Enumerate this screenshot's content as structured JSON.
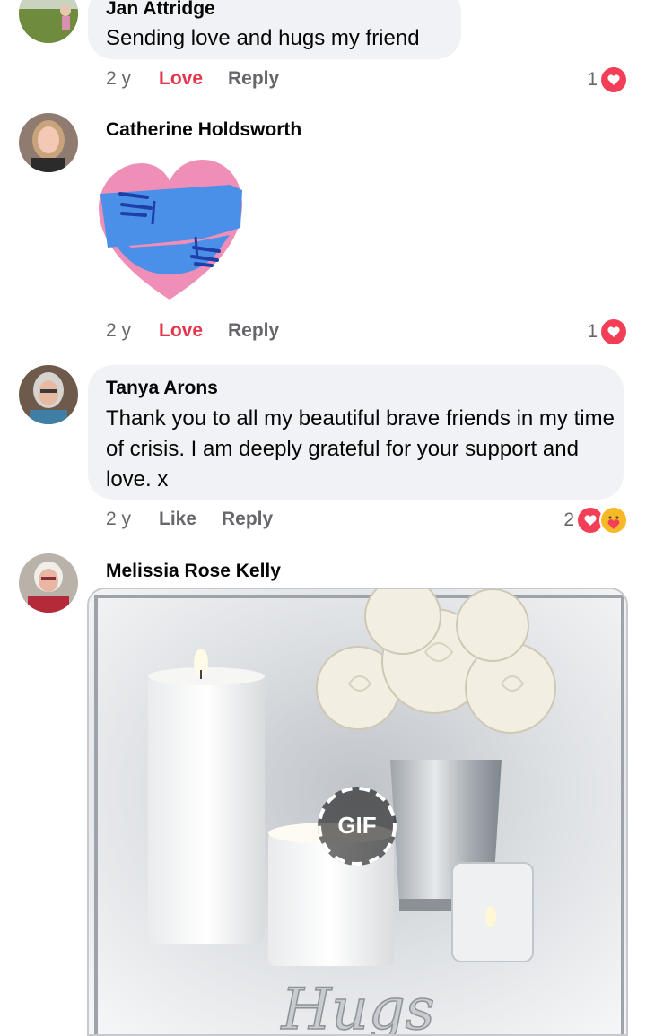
{
  "comments": [
    {
      "author": "Jan Attridge",
      "text": "Sending love and hugs my friend",
      "time": "2 y",
      "action_1": "Love",
      "action_2": "Reply",
      "reaction_count": "1"
    },
    {
      "author": "Catherine Holdsworth",
      "sticker": "heart-hug-sticker",
      "time": "2 y",
      "action_1": "Love",
      "action_2": "Reply",
      "reaction_count": "1"
    },
    {
      "author": "Tanya Arons",
      "text": "Thank you to all my beautiful brave friends in my time of crisis.  I am deeply grateful for your support and love. x",
      "time": "2 y",
      "action_1": "Like",
      "action_2": "Reply",
      "reaction_count": "2"
    },
    {
      "author": "Melissia Rose Kelly",
      "gif_label": "GIF",
      "gif_caption": "Hugs"
    }
  ],
  "colors": {
    "love": "#e4364b",
    "meta": "#65676b",
    "bubble": "#f0f2f5",
    "heart_reaction": "#f33e58",
    "care_reaction": "#f7b928"
  },
  "icons": [
    "heart-reaction-icon",
    "care-reaction-icon",
    "gif-play-icon"
  ]
}
